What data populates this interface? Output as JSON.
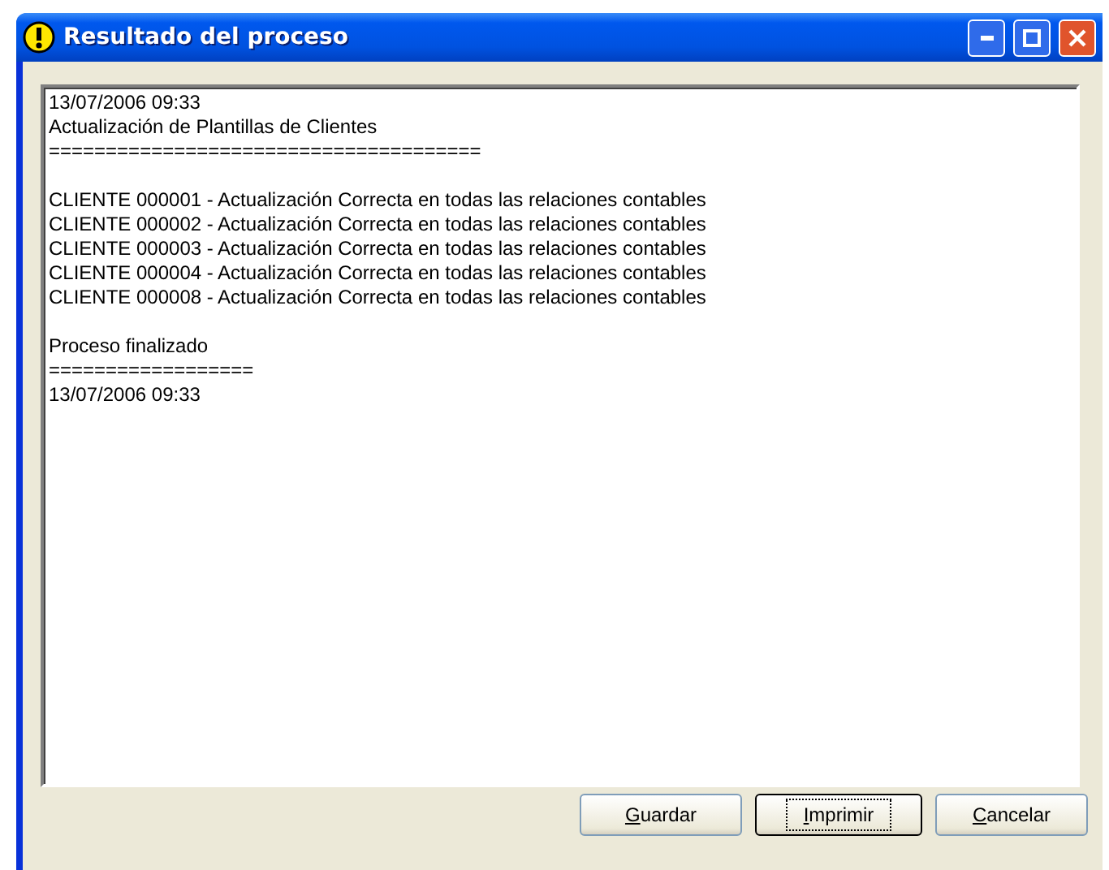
{
  "window": {
    "title": "Resultado del proceso"
  },
  "log": {
    "blocks": [
      [
        "13/07/2006 09:33",
        "Actualización de Plantillas de Clientes",
        "======================================"
      ],
      [
        "CLIENTE 000001 - Actualización Correcta en todas las relaciones contables",
        "CLIENTE 000002 - Actualización Correcta en todas las relaciones contables",
        "CLIENTE 000003 - Actualización Correcta en todas las relaciones contables",
        "CLIENTE 000004 - Actualización Correcta en todas las relaciones contables",
        "CLIENTE 000008 - Actualización Correcta en todas las relaciones contables"
      ],
      [
        "Proceso finalizado",
        "==================",
        "13/07/2006 09:33"
      ]
    ]
  },
  "buttons": [
    {
      "label": "Guardar",
      "focused": false
    },
    {
      "label": "Imprimir",
      "focused": true
    },
    {
      "label": "Cancelar",
      "focused": false
    }
  ]
}
